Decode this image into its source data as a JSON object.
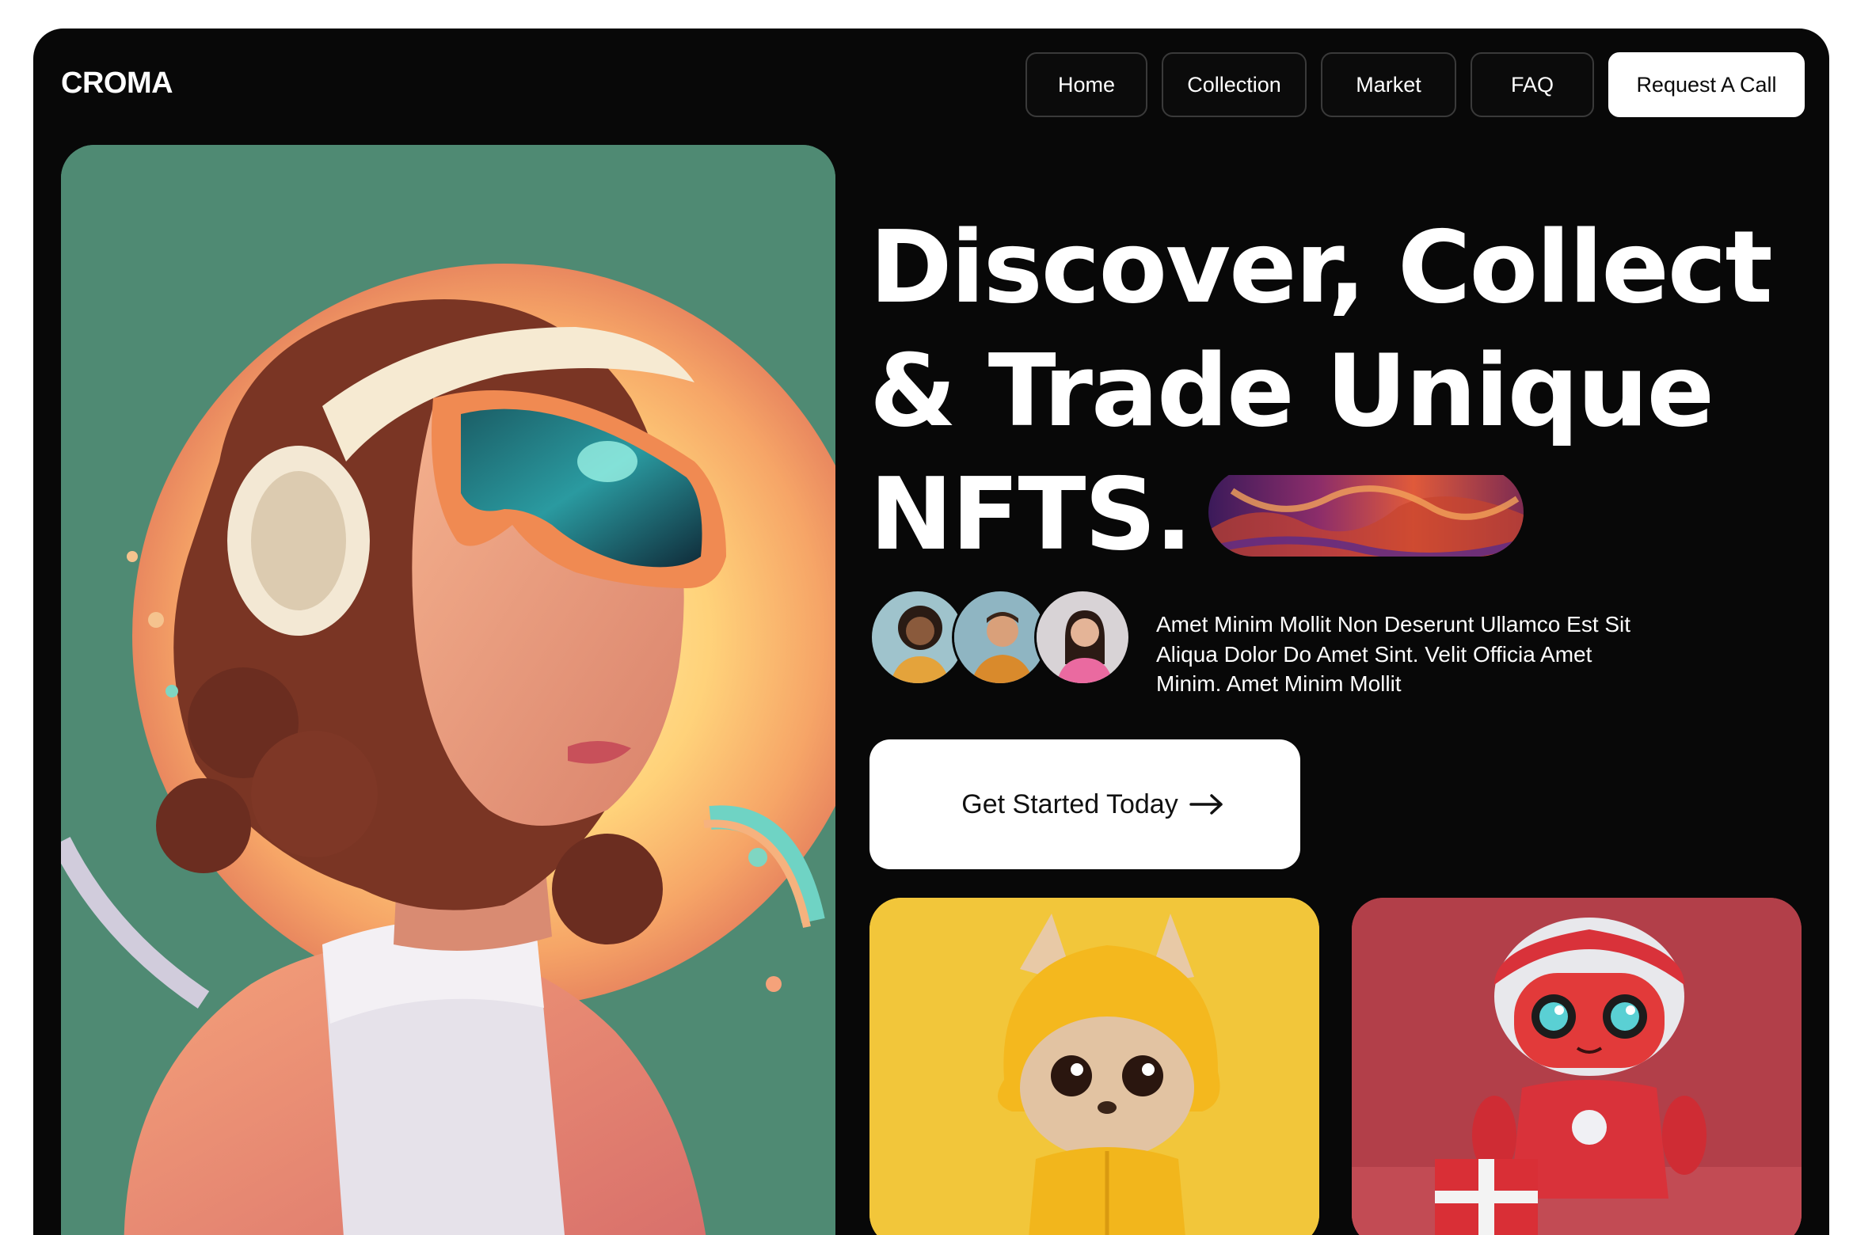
{
  "header": {
    "logo": "CROMA",
    "nav": [
      {
        "label": "Home"
      },
      {
        "label": "Collection"
      },
      {
        "label": "Market"
      },
      {
        "label": "FAQ"
      }
    ],
    "cta_label": "Request A Call"
  },
  "hero": {
    "headline_line1": "Discover, Collect",
    "headline_line2": "& Trade Unique",
    "headline_line3": "NFTS.",
    "description": "Amet Minim Mollit Non Deserunt Ullamco Est Sit Aliqua Dolor Do Amet Sint. Velit Officia Amet Minim. Amet Minim Mollit",
    "cta_label": "Get Started Today"
  },
  "colors": {
    "background": "#080808",
    "hero_green": "#4f8a73",
    "cat_card": "#f2c63a",
    "robot_card": "#b23f49",
    "button_light": "#ffffff"
  },
  "icons": [
    "arrow-right-icon"
  ]
}
